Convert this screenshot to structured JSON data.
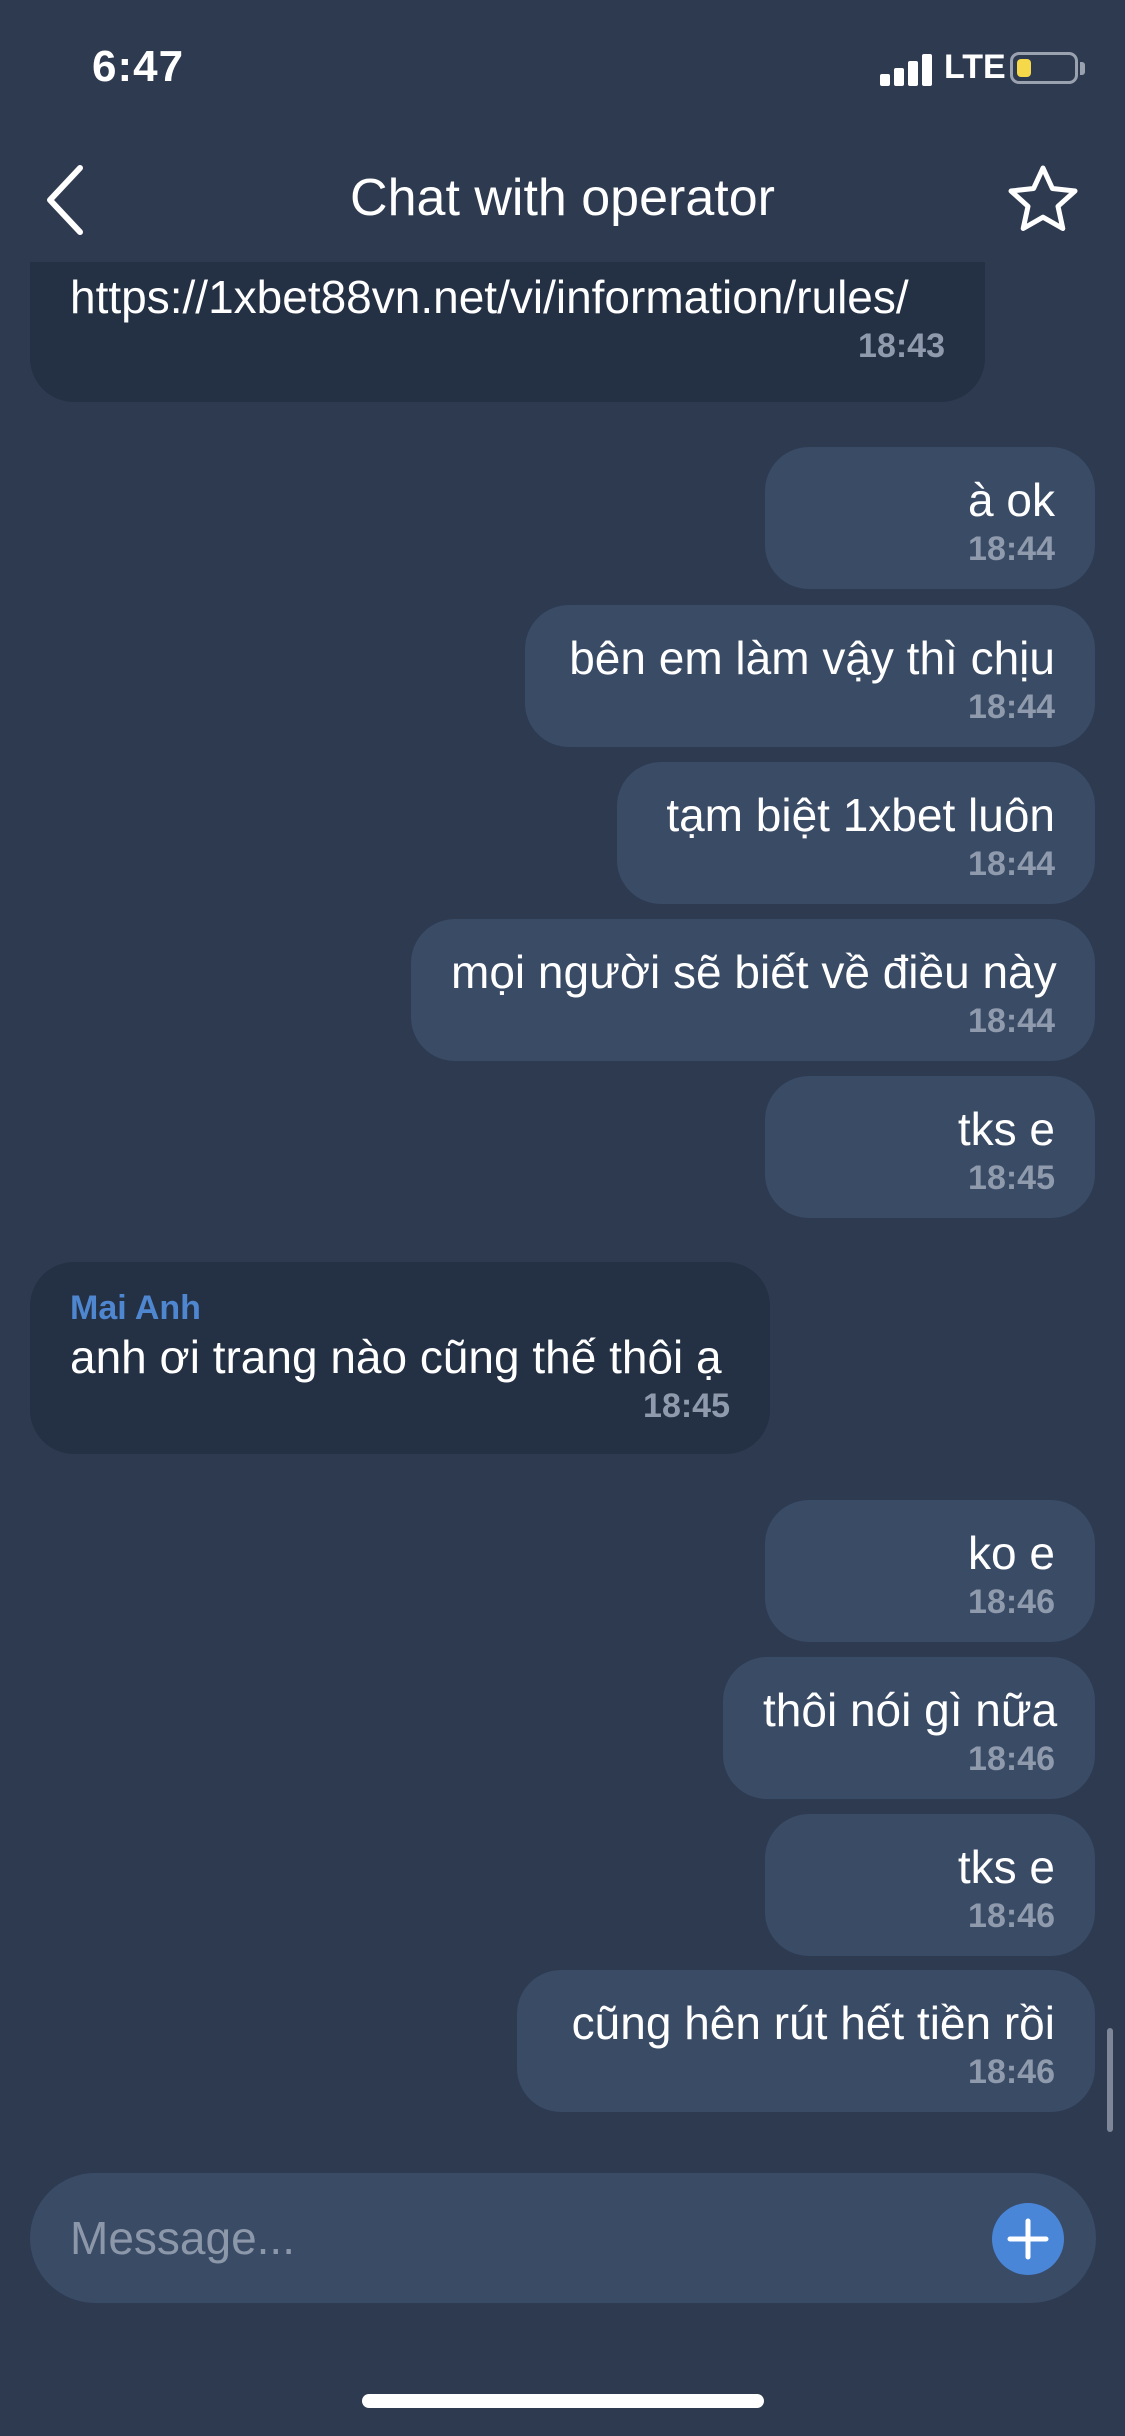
{
  "status_bar": {
    "time": "6:47",
    "network": "LTE",
    "battery_level": 0.25,
    "battery_color": "#f5d94a"
  },
  "header": {
    "title": "Chat with operator",
    "back_icon": "chevron-left-icon",
    "favorite_icon": "star-outline-icon"
  },
  "messages": [
    {
      "direction": "in",
      "sender": "Mai Anh",
      "text": "https://1xbet88vn.net/vi/information/rules/",
      "time": "18:43"
    },
    {
      "direction": "out",
      "text": "à ok",
      "time": "18:44"
    },
    {
      "direction": "out",
      "text": "bên em làm vậy thì chịu",
      "time": "18:44"
    },
    {
      "direction": "out",
      "text": "tạm biệt 1xbet luôn",
      "time": "18:44"
    },
    {
      "direction": "out",
      "text": "mọi người sẽ biết về điều này",
      "time": "18:44"
    },
    {
      "direction": "out",
      "text": "tks e",
      "time": "18:45"
    },
    {
      "direction": "in",
      "sender": "Mai Anh",
      "text": "anh ơi trang nào cũng thế thôi ạ",
      "time": "18:45"
    },
    {
      "direction": "out",
      "text": "ko e",
      "time": "18:46"
    },
    {
      "direction": "out",
      "text": "thôi nói gì nữa",
      "time": "18:46"
    },
    {
      "direction": "out",
      "text": "tks e",
      "time": "18:46"
    },
    {
      "direction": "out",
      "text": "cũng hên rút hết tiền rồi",
      "time": "18:46"
    }
  ],
  "composer": {
    "placeholder": "Message...",
    "add_icon": "plus-icon"
  },
  "colors": {
    "background": "#2e3a50",
    "outgoing_bubble": "#3a4b66",
    "incoming_bubble": "#243044",
    "sender_name": "#4f86d0",
    "accent": "#4a86d8"
  }
}
